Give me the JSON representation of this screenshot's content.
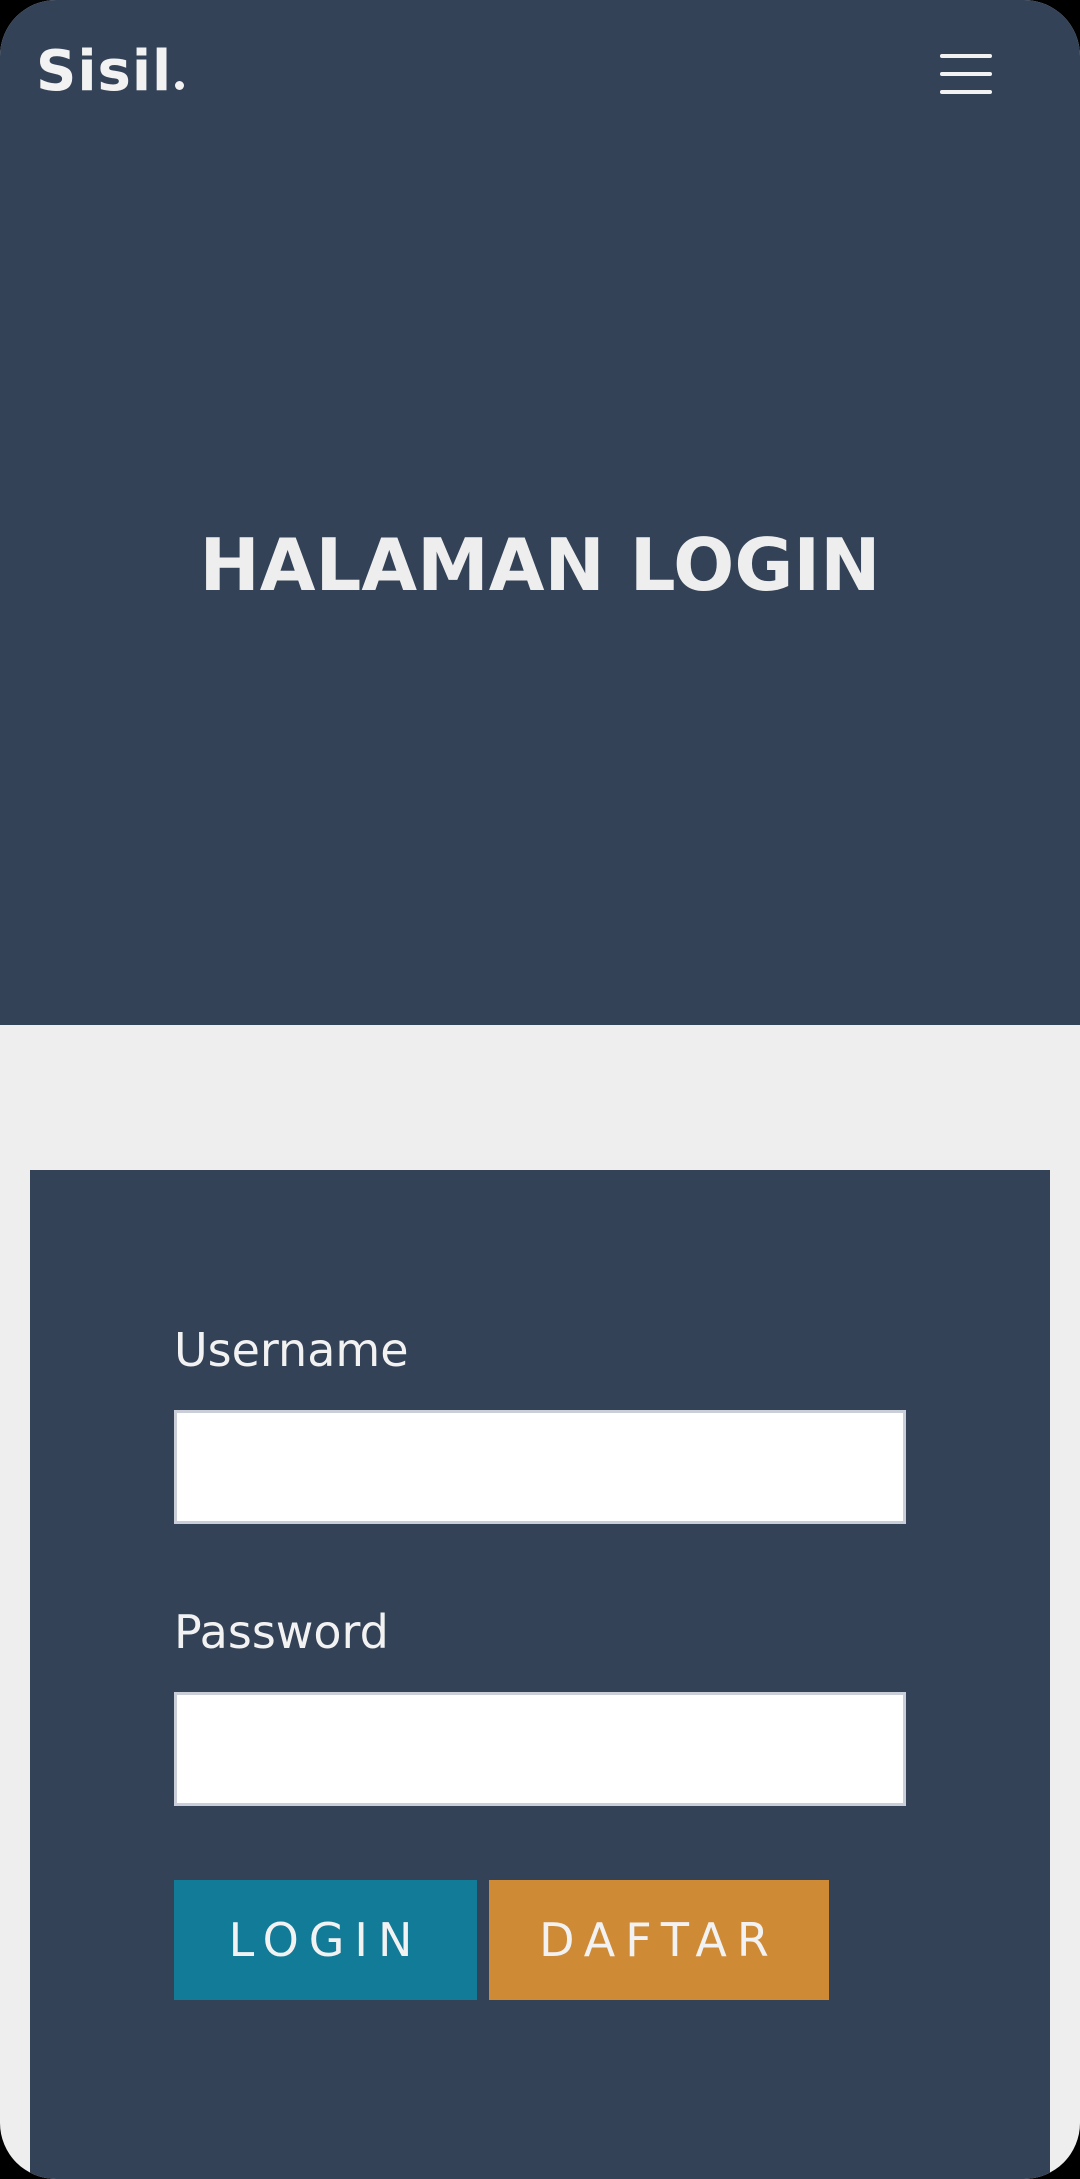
{
  "brand": {
    "name": "Sisil"
  },
  "header": {
    "menu_icon": "hamburger-icon"
  },
  "hero": {
    "title": "HALAMAN LOGIN"
  },
  "form": {
    "username_label": "Username",
    "username_value": "",
    "password_label": "Password",
    "password_value": "",
    "login_label": "LOGIN",
    "register_label": "DAFTAR"
  },
  "colors": {
    "primary_dark": "#344257",
    "page_background": "#eeeeee",
    "login_button": "#127b98",
    "register_button": "#cf8a36",
    "text_light": "#f2f2f2"
  }
}
